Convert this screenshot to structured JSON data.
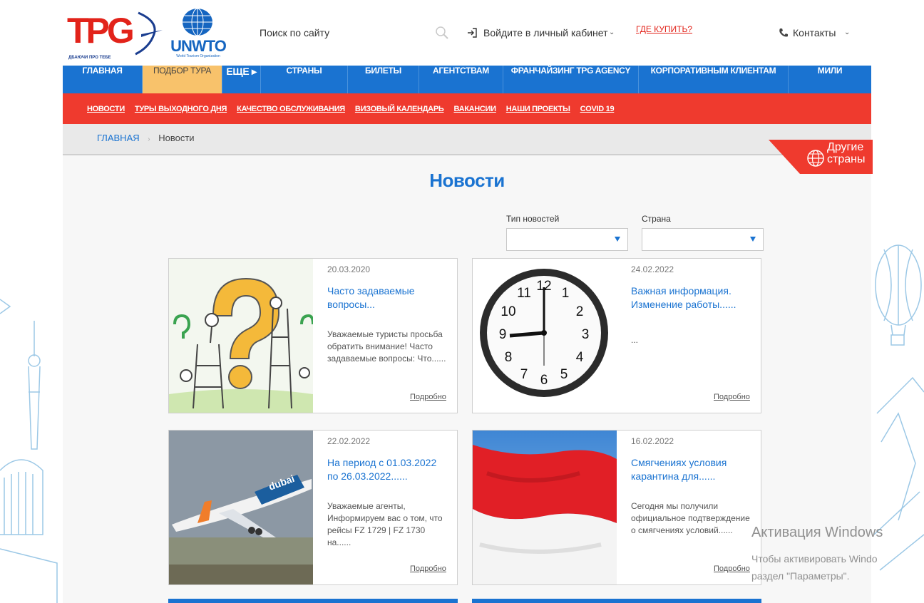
{
  "header": {
    "logo_tpg": "TPG",
    "logo_tagline": "ДБАЮЧИ ПРО ТЕБЕ",
    "logo_unwto": "UNWTO",
    "logo_unwto_sub": "World Tourism Organization",
    "search_placeholder": "Поиск по сайту",
    "login_label": "Войдите в личный кабинет",
    "where_buy": "ГДЕ КУПИТЬ?",
    "contacts_label": "Контакты",
    "caret": "⌄"
  },
  "main_nav": {
    "items": [
      {
        "label": "ГЛАВНАЯ",
        "active": false
      },
      {
        "label": "ПОДБОР ТУРА",
        "active": true
      },
      {
        "label": "ЕЩЕ ▸",
        "active": false
      },
      {
        "label": "СТРАНЫ",
        "active": false
      },
      {
        "label": "БИЛЕТЫ",
        "active": false
      },
      {
        "label": "АГЕНТСТВАМ",
        "active": false
      },
      {
        "label": "ФРАНЧАЙЗИНГ TPG AGENCY",
        "active": false
      },
      {
        "label": "КОРПОРАТИВНЫМ КЛИЕНТАМ",
        "active": false
      },
      {
        "label": "МИЛИ",
        "active": false
      }
    ]
  },
  "sub_nav": {
    "items": [
      "НОВОСТИ",
      "ТУРЫ ВЫХОДНОГО ДНЯ",
      "КАЧЕСТВО ОБСЛУЖИВАНИЯ",
      "ВИЗОВЫЙ КАЛЕНДАРЬ",
      "ВАКАНСИИ",
      "НАШИ ПРОЕКТЫ",
      "COVID 19"
    ]
  },
  "breadcrumb": {
    "home": "ГЛАВНАЯ",
    "separator": "›",
    "current": "Новости"
  },
  "other_countries": {
    "line1": "Другие",
    "line2": "страны"
  },
  "page": {
    "title": "Новости"
  },
  "filters": {
    "type_label": "Тип новостей",
    "type_value": "",
    "country_label": "Страна",
    "country_value": ""
  },
  "news": [
    {
      "date": "20.03.2020",
      "title": "Часто задаваемые вопросы...",
      "text": "Уважаемые туристы просьба обратить внимание! Часто задаваемые вопросы: Что......",
      "more": "Подробно",
      "image": "question-mark-illustration"
    },
    {
      "date": "24.02.2022",
      "title": "Важная информация. Изменение работы......",
      "text": "...",
      "more": "Подробно",
      "image": "wall-clock"
    },
    {
      "date": "22.02.2022",
      "title": "На период с 01.03.2022 по 26.03.2022......",
      "text": "Уважаемые агенты, Информируем вас о том, что рейсы FZ 1729 | FZ 1730 на......",
      "more": "Подробно",
      "image": "flydubai-airplane"
    },
    {
      "date": "16.02.2022",
      "title": "Смягчениях условия карантина для......",
      "text": "Сегодня мы получили официальное подтверждение о смягчениях условий......",
      "more": "Подробно",
      "image": "red-white-flag"
    }
  ],
  "clock_numbers": [
    "12",
    "1",
    "2",
    "3",
    "4",
    "5",
    "6",
    "7",
    "8",
    "9",
    "10",
    "11"
  ],
  "plane_livery": "dubai",
  "windows_watermark": {
    "title": "Активация Windows",
    "line1": "Чтобы активировать Windo",
    "line2": "раздел \"Параметры\"."
  },
  "colors": {
    "nav_blue": "#1a73d1",
    "sub_nav_red": "#ef3a2e",
    "active_tab": "#f8c26b",
    "brand_red": "#e2231a"
  }
}
